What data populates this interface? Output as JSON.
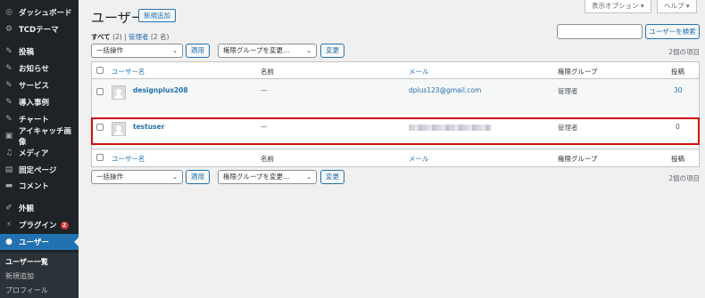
{
  "sidebar": {
    "items": [
      {
        "label": "ダッシュボード",
        "icon": "dashboard-icon",
        "glyph": "◎"
      },
      {
        "label": "TCDテーマ",
        "icon": "gear-icon",
        "glyph": "⚙"
      },
      {
        "label": "投稿",
        "icon": "pin-icon",
        "glyph": "✎"
      },
      {
        "label": "お知らせ",
        "icon": "pin-icon",
        "glyph": "✎"
      },
      {
        "label": "サービス",
        "icon": "pin-icon",
        "glyph": "✎"
      },
      {
        "label": "導入事例",
        "icon": "pin-icon",
        "glyph": "✎"
      },
      {
        "label": "チャート",
        "icon": "pin-icon",
        "glyph": "✎"
      },
      {
        "label": "アイキャッチ画像",
        "icon": "image-icon",
        "glyph": "▣"
      },
      {
        "label": "メディア",
        "icon": "media-icon",
        "glyph": "♫"
      },
      {
        "label": "固定ページ",
        "icon": "page-icon",
        "glyph": "▤"
      },
      {
        "label": "コメント",
        "icon": "comment-icon",
        "glyph": "▬"
      },
      {
        "label": "外観",
        "icon": "brush-icon",
        "glyph": "✐"
      },
      {
        "label": "プラグイン",
        "icon": "plugin-icon",
        "glyph": "⚡",
        "badge": "2"
      },
      {
        "label": "ユーザー",
        "icon": "user-icon",
        "glyph": "●"
      }
    ],
    "submenu": [
      "ユーザー一覧",
      "新規追加",
      "プロフィール"
    ]
  },
  "header": {
    "title": "ユーザー",
    "add_new": "新規追加",
    "screen_options": "表示オプション ▾",
    "help": "ヘルプ ▾"
  },
  "filters": {
    "all": "すべて",
    "all_count": "(2)",
    "sep": "|",
    "admin": "管理者",
    "admin_count": "(2 名)"
  },
  "search": {
    "button": "ユーザーを検索",
    "value": ""
  },
  "bulk": {
    "action": "一括操作",
    "apply": "適用",
    "role": "権限グループを変更...",
    "change": "変更",
    "count": "2個の項目"
  },
  "table": {
    "columns": [
      "ユーザー名",
      "名前",
      "メール",
      "権限グループ",
      "投稿"
    ],
    "rows": [
      {
        "username": "designplus208",
        "name": "—",
        "email": "dplus123@gmail.com",
        "role": "管理者",
        "posts": "30"
      },
      {
        "username": "testuser",
        "name": "—",
        "email": "",
        "role": "管理者",
        "posts": "0"
      }
    ]
  }
}
